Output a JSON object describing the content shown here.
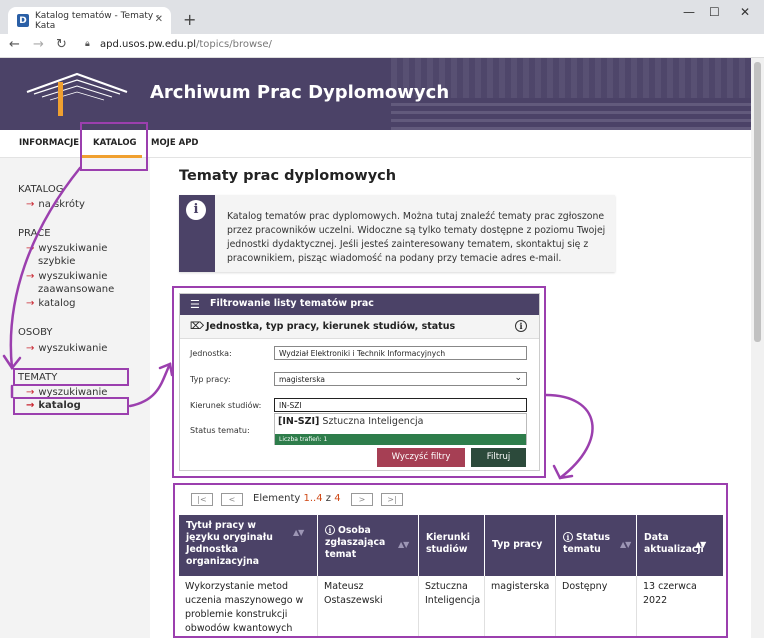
{
  "browser": {
    "tab_title": "Katalog tematów - Tematy - Kata",
    "tab_favicon": "D",
    "url_host": "apd.usos.pw.edu.pl",
    "url_path": "/topics/browse/"
  },
  "header": {
    "site_title": "Archiwum Prac Dyplomowych"
  },
  "menu": {
    "items": [
      "INFORMACJE",
      "KATALOG",
      "MOJE APD"
    ]
  },
  "sidebar": {
    "katalog_heading": "KATALOG",
    "katalog_items": [
      "na skróty"
    ],
    "prace_heading": "PRACE",
    "prace_items": [
      "wyszukiwanie szybkie",
      "wyszukiwanie zaawansowane",
      "katalog"
    ],
    "osoby_heading": "OSOBY",
    "osoby_items": [
      "wyszukiwanie"
    ],
    "tematy_heading": "TEMATY",
    "tematy_items": [
      "wyszukiwanie",
      "katalog"
    ]
  },
  "page": {
    "title": "Tematy prac dyplomowych",
    "info_text": "Katalog tematów prac dyplomowych. Można tutaj znaleźć tematy prac zgłoszone przez pracowników uczelni. Widoczne są tylko tematy dostępne z poziomu Twojej jednostki dydaktycznej. Jeśli jesteś zainteresowany tematem, skontaktuj się z pracownikiem, pisząc wiadomość na podany przy temacie adres e-mail."
  },
  "filter": {
    "header": "Filtrowanie listy tematów prac",
    "section": "Jednostka, typ pracy, kierunek studiów, status",
    "jednostka_label": "Jednostka:",
    "jednostka_value": "Wydział Elektroniki i Technik Informacyjnych",
    "typ_label": "Typ pracy:",
    "typ_value": "magisterska",
    "kierunek_label": "Kierunek studiów:",
    "kierunek_value": "IN-SZI",
    "status_label": "Status tematu:",
    "suggestion_code": "[IN-SZI]",
    "suggestion_name": "Sztuczna Inteligencja",
    "suggestion_count": "Liczba trafień: 1",
    "clear_button": "Wyczyść filtry",
    "filter_button": "Filtruj"
  },
  "pager": {
    "label": "Elementy",
    "range": "1..4",
    "of": "z",
    "total": "4",
    "first": "|<",
    "prev": "<",
    "next": ">",
    "last": ">|"
  },
  "table": {
    "headers": [
      "Tytuł pracy w języku oryginału Jednostka organizacyjna",
      "Osoba zgłaszająca temat",
      "Kierunki studiów",
      "Typ pracy",
      "Status tematu",
      "Data aktualizacji"
    ],
    "rows": [
      [
        "Wykorzystanie metod uczenia maszynowego w problemie konstrukcji obwodów kwantowych",
        "Mateusz Ostaszewski",
        "Sztuczna Inteligencja",
        "magisterska",
        "Dostępny",
        "13 czerwca 2022"
      ]
    ]
  },
  "colors": {
    "brand_purple": "#4b4267",
    "annotation": "#9b3fae",
    "clear_button": "#a63f54",
    "filter_button": "#2c4a3b",
    "count_bar": "#2e7d4b",
    "accent_orange": "#f0a030",
    "arrow_red": "#c8242f"
  }
}
